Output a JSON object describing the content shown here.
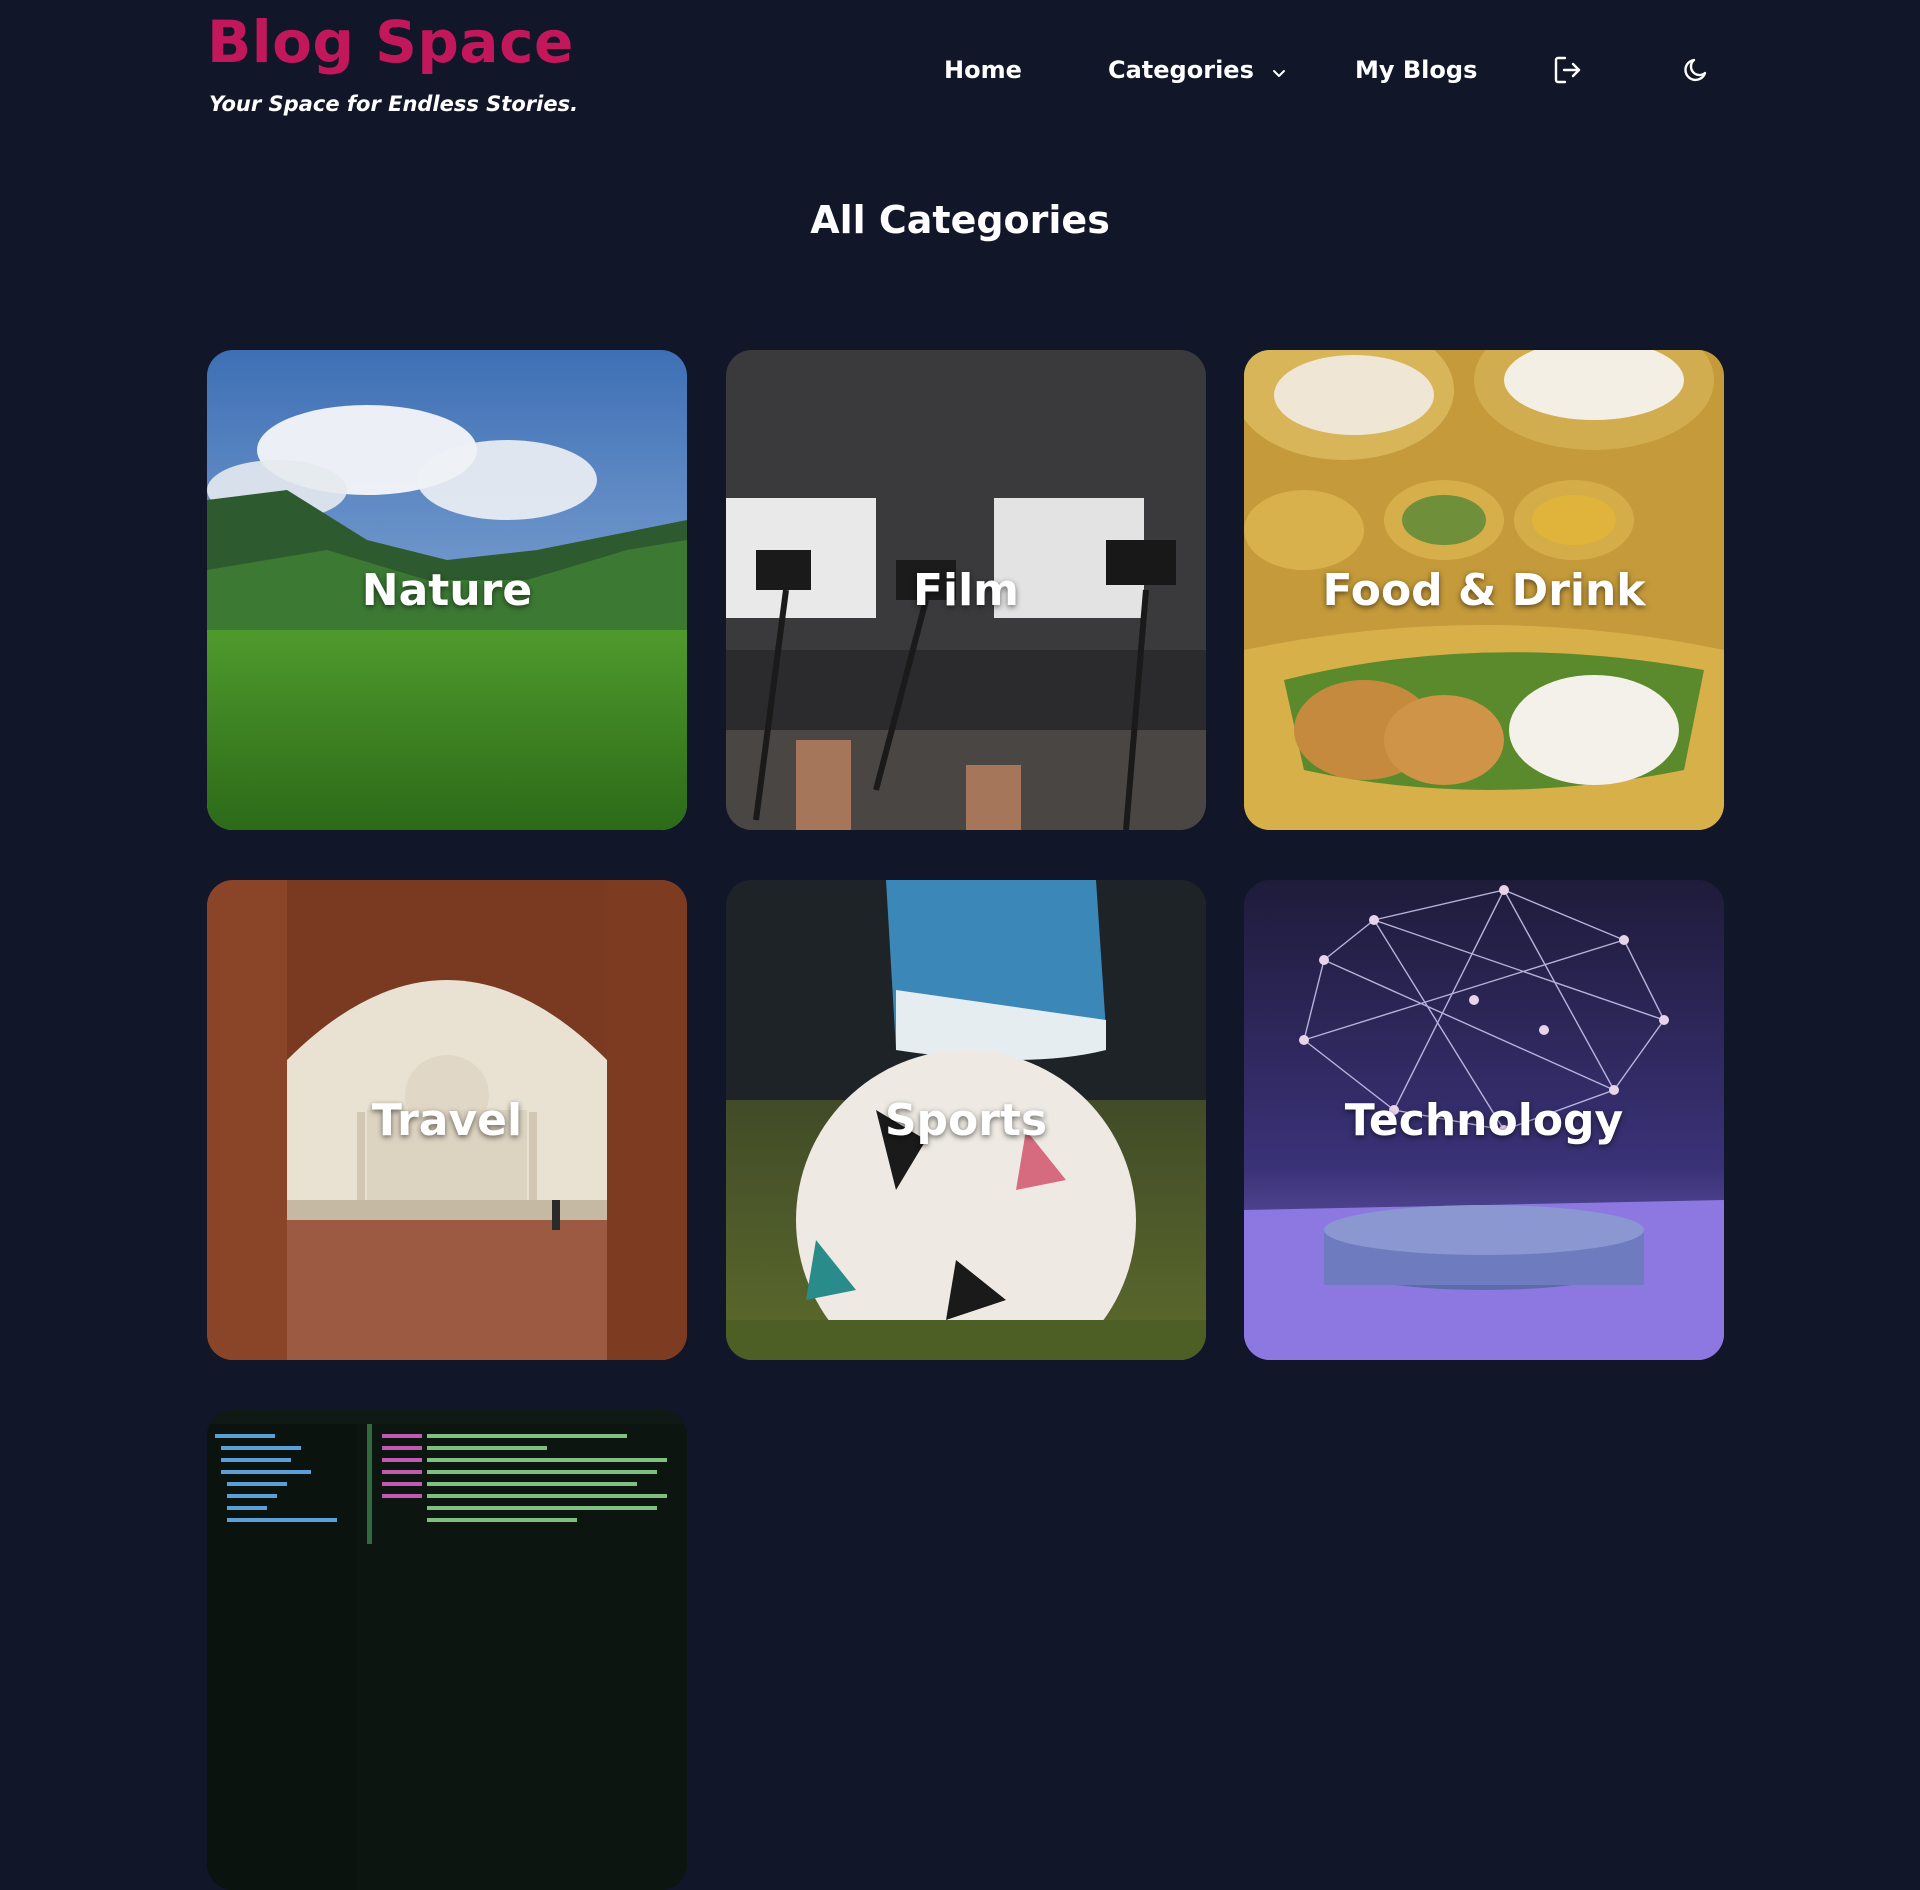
{
  "brand": {
    "title": "Blog Space",
    "tagline": "Your Space for Endless Stories."
  },
  "nav": {
    "home": "Home",
    "categories": "Categories",
    "my_blogs": "My Blogs",
    "logout_icon": "logout-icon",
    "theme_icon": "moon-icon"
  },
  "page": {
    "title": "All Categories"
  },
  "categories": [
    {
      "label": "Nature",
      "image": "mountain-meadow"
    },
    {
      "label": "Film",
      "image": "film-cameras"
    },
    {
      "label": "Food & Drink",
      "image": "indian-thali"
    },
    {
      "label": "Travel",
      "image": "taj-mahal-arch"
    },
    {
      "label": "Sports",
      "image": "football-boot"
    },
    {
      "label": "Technology",
      "image": "network-brain"
    },
    {
      "label": "",
      "image": "code-editor"
    }
  ],
  "colors": {
    "background": "#111729",
    "brand": "#c2185b",
    "text": "#ffffff"
  }
}
